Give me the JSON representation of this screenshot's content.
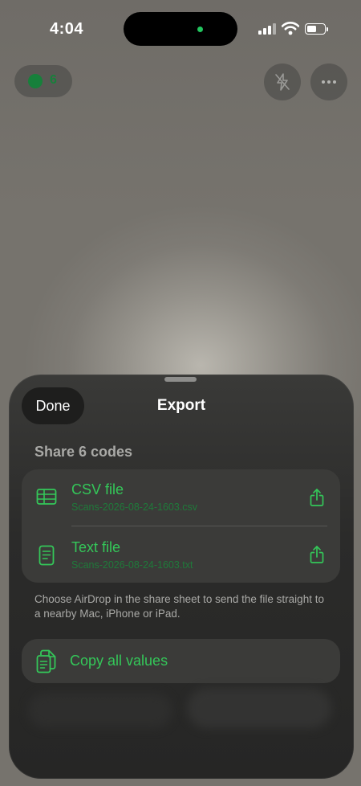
{
  "status_bar": {
    "time": "4:04"
  },
  "camera": {
    "scan_count": "6"
  },
  "sheet": {
    "done_label": "Done",
    "title": "Export",
    "section_title": "Share 6 codes",
    "options": [
      {
        "label": "CSV file",
        "filename": "Scans-2026-08-24-1603.csv",
        "icon": "table-icon"
      },
      {
        "label": "Text file",
        "filename": "Scans-2026-08-24-1603.txt",
        "icon": "document-icon"
      }
    ],
    "note": "Choose AirDrop in the share sheet to send the file straight to a nearby Mac, iPhone or iPad.",
    "copy_label": "Copy all values"
  },
  "colors": {
    "accent": "#34c759",
    "accent_dim": "#1f7a3a",
    "sheet_background": "#2b2b2a",
    "card_background": "#3b3b39"
  }
}
